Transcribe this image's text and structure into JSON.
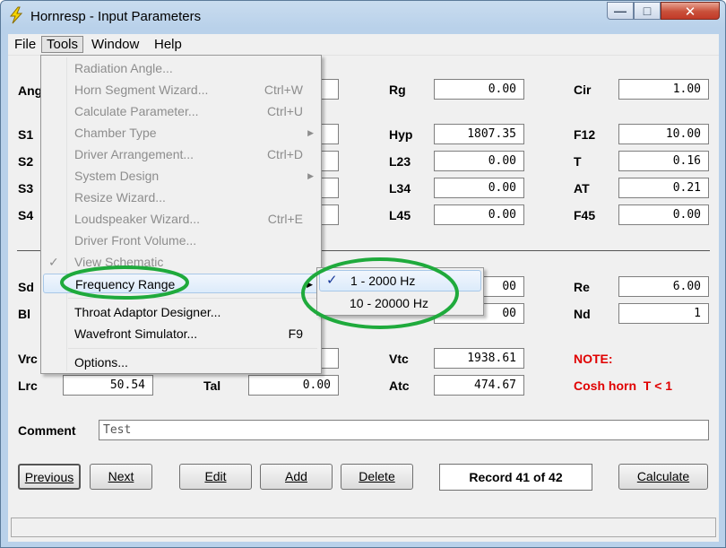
{
  "window": {
    "title": "Hornresp - Input Parameters",
    "controls": {
      "minimize": "—",
      "maximize": "□",
      "close": "✕"
    }
  },
  "menubar": [
    "File",
    "Tools",
    "Window",
    "Help"
  ],
  "tools_menu": {
    "items": [
      {
        "label": "Radiation Angle...",
        "shortcut": "",
        "enabled": false,
        "submenu": false
      },
      {
        "label": "Horn Segment Wizard...",
        "shortcut": "Ctrl+W",
        "enabled": false,
        "submenu": false
      },
      {
        "label": "Calculate Parameter...",
        "shortcut": "Ctrl+U",
        "enabled": false,
        "submenu": false
      },
      {
        "label": "Chamber Type",
        "shortcut": "",
        "enabled": false,
        "submenu": true
      },
      {
        "label": "Driver Arrangement...",
        "shortcut": "Ctrl+D",
        "enabled": false,
        "submenu": false
      },
      {
        "label": "System Design",
        "shortcut": "",
        "enabled": false,
        "submenu": true
      },
      {
        "label": "Resize Wizard...",
        "shortcut": "",
        "enabled": false,
        "submenu": false
      },
      {
        "label": "Loudspeaker Wizard...",
        "shortcut": "Ctrl+E",
        "enabled": false,
        "submenu": false
      },
      {
        "label": "Driver Front Volume...",
        "shortcut": "",
        "enabled": false,
        "submenu": false
      },
      {
        "label": "View Schematic",
        "shortcut": "",
        "enabled": false,
        "submenu": false,
        "checked": true
      },
      {
        "label": "Frequency Range",
        "shortcut": "",
        "enabled": true,
        "submenu": true,
        "highlighted": true
      },
      {
        "label": "Throat Adaptor Designer...",
        "shortcut": "",
        "enabled": true,
        "submenu": false
      },
      {
        "label": "Wavefront Simulator...",
        "shortcut": "F9",
        "enabled": true,
        "submenu": false
      },
      {
        "label": "Options...",
        "shortcut": "",
        "enabled": true,
        "submenu": false
      }
    ]
  },
  "frequency_submenu": [
    {
      "label": "1 - 2000 Hz",
      "checked": true
    },
    {
      "label": "10 - 20000 Hz",
      "checked": false
    }
  ],
  "fields": {
    "labels_left": {
      "ang": "Ang",
      "s1": "S1",
      "s2": "S2",
      "s3": "S3",
      "s4": "S4",
      "sd": "Sd",
      "bl": "Bl",
      "vrc": "Vrc",
      "lrc": "Lrc"
    },
    "lrc_value": "50.54",
    "tal": {
      "label": "Tal",
      "value": "0.00"
    },
    "col2": [
      {
        "label": "Rg",
        "value": "0.00"
      },
      {
        "label": "Hyp",
        "value": "1807.35"
      },
      {
        "label": "L23",
        "value": "0.00"
      },
      {
        "label": "L34",
        "value": "0.00"
      },
      {
        "label": "L45",
        "value": "0.00"
      }
    ],
    "col3": [
      {
        "label": "Cir",
        "value": "1.00"
      },
      {
        "label": "F12",
        "value": "10.00"
      },
      {
        "label": "T",
        "value": "0.16"
      },
      {
        "label": "AT",
        "value": "0.21"
      },
      {
        "label": "F45",
        "value": "0.00"
      }
    ],
    "col2_lower": {
      "sd_partial": "00",
      "bl_partial": "00"
    },
    "vtc": {
      "label": "Vtc",
      "value": "1938.61"
    },
    "atc": {
      "label": "Atc",
      "value": "474.67"
    },
    "re": {
      "label": "Re",
      "value": "6.00"
    },
    "nd": {
      "label": "Nd",
      "value": "1"
    },
    "note_label": "NOTE:",
    "note_text": "Cosh horn  T < 1",
    "comment": {
      "label": "Comment",
      "value": "Test"
    }
  },
  "buttons": {
    "previous": "Previous",
    "next": "Next",
    "edit": "Edit",
    "add": "Add",
    "delete": "Delete",
    "record": "Record 41 of 42",
    "calculate": "Calculate"
  },
  "colors": {
    "annotation_green": "#1faa3c",
    "note_red": "#e00000",
    "check_blue": "#1a3a9a"
  }
}
